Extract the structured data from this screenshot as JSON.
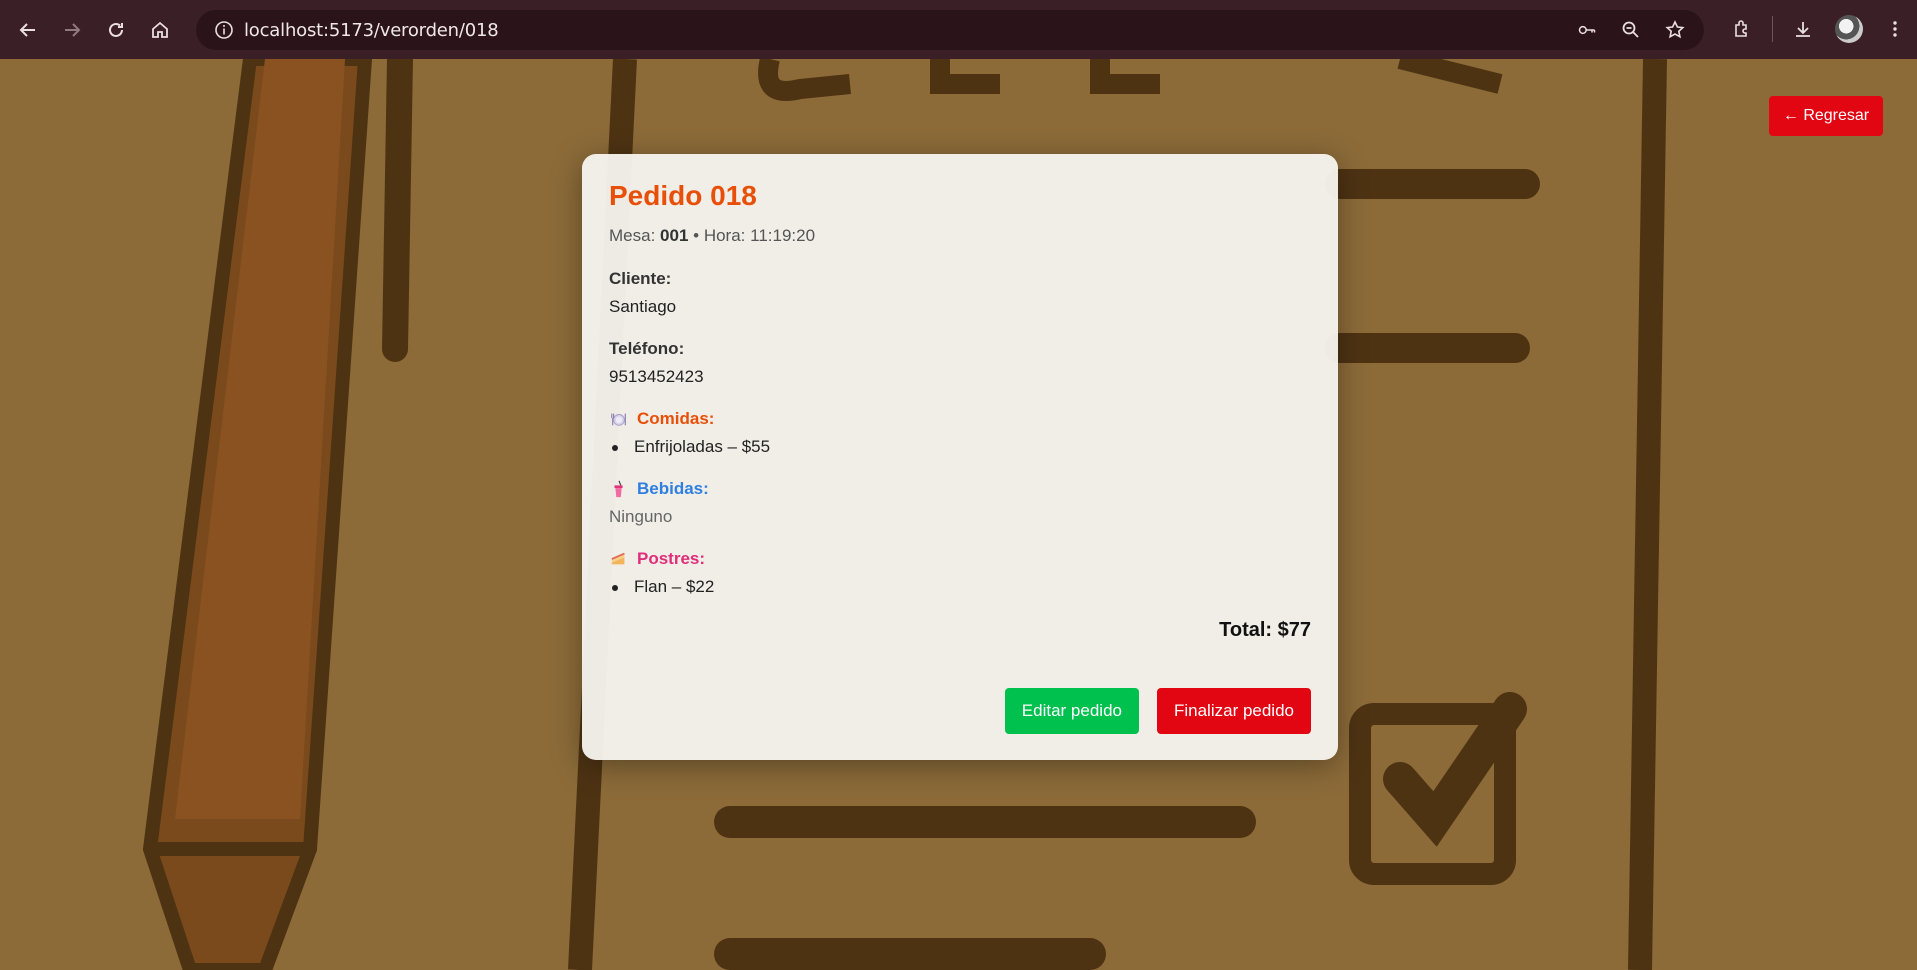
{
  "browser": {
    "url": "localhost:5173/verorden/018"
  },
  "page": {
    "back_label": "← Regresar"
  },
  "order": {
    "title": "Pedido 018",
    "mesa_label": "Mesa:",
    "mesa_value": "001",
    "separator": "•",
    "hora_label": "Hora:",
    "hora_value": "11:19:20",
    "cliente_label": "Cliente:",
    "cliente_value": "Santiago",
    "telefono_label": "Teléfono:",
    "telefono_value": "9513452423",
    "comidas": {
      "icon": "plate-icon",
      "label": "Comidas:",
      "items": [
        "Enfrijoladas – $55"
      ]
    },
    "bebidas": {
      "icon": "drink-icon",
      "label": "Bebidas:",
      "empty_text": "Ninguno"
    },
    "postres": {
      "icon": "cake-icon",
      "label": "Postres:",
      "items": [
        "Flan – $22"
      ]
    },
    "total": "Total: $77",
    "edit_label": "Editar pedido",
    "finish_label": "Finalizar pedido"
  },
  "colors": {
    "title": "#e8500a",
    "green_button": "#00c04e",
    "red_button": "#e20613",
    "comidas": "#e8500a",
    "bebidas": "#2f7fe0",
    "postres": "#e02e7a"
  }
}
